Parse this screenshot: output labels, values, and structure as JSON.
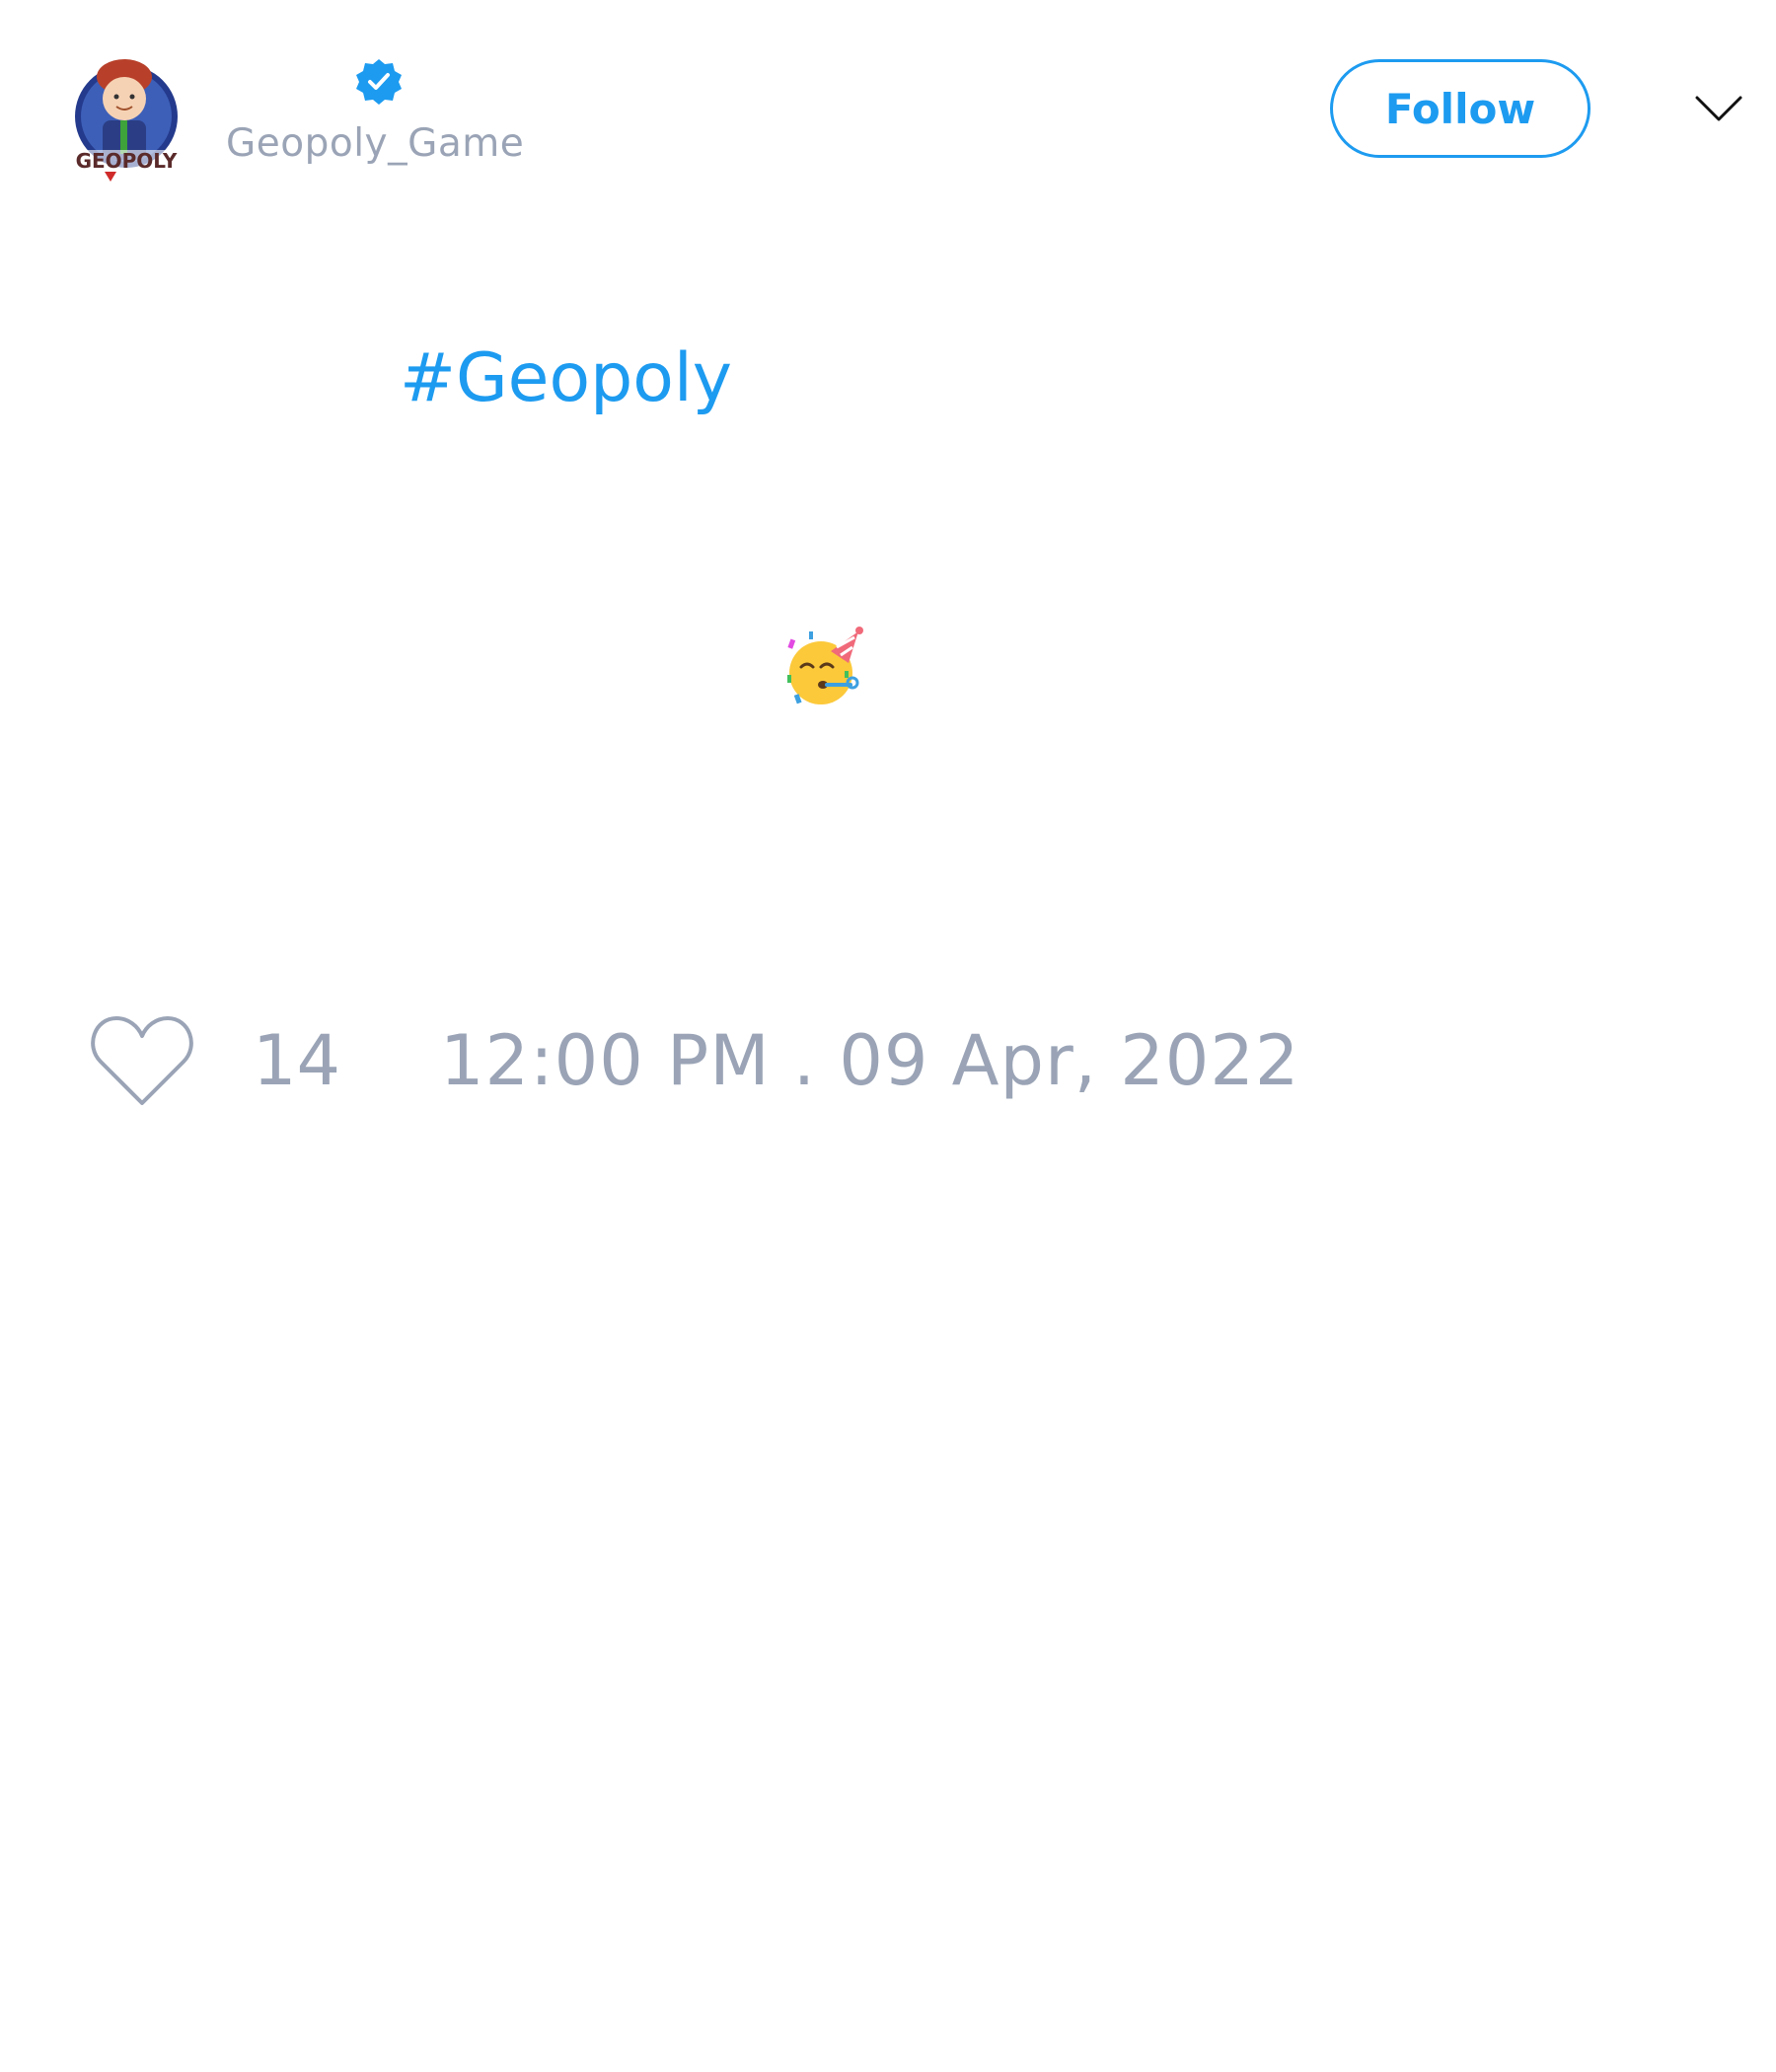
{
  "author": {
    "handle": "Geopoly_Game",
    "verified": true,
    "avatar_icon": "geopoly-logo-avatar",
    "avatar_text": "GEOPOLY"
  },
  "header": {
    "follow_label": "Follow",
    "menu_icon": "chevron-down-icon"
  },
  "tweet": {
    "hashtag": "#Geopoly",
    "emoji_icon": "partying-face-emoji"
  },
  "footer": {
    "like_icon": "heart-icon",
    "like_count": "14",
    "timestamp": "12:00 PM . 09 Apr, 2022"
  },
  "colors": {
    "accent": "#1d9bf0",
    "muted_text": "#9aa4b6",
    "background": "#ffffff"
  }
}
